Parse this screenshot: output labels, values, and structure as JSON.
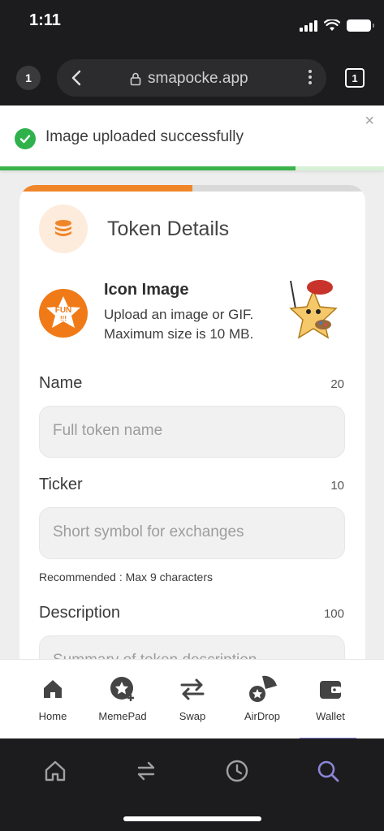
{
  "status_bar": {
    "time": "1:11"
  },
  "browser": {
    "tab_count_left": "1",
    "url": "smapocke.app",
    "tabs_count": "1"
  },
  "toast": {
    "message": "Image uploaded successfully",
    "close": "×",
    "progress": 0.77,
    "accent": "#3bb34a"
  },
  "card": {
    "progress": 0.5,
    "progress_color": "#f0862a",
    "title": "Token Details",
    "icon_section": {
      "logo_text": "FUN!!!",
      "title": "Icon Image",
      "desc_line1": "Upload an image or GIF.",
      "desc_line2": "Maximum size is 10 MB."
    },
    "fields": {
      "name": {
        "label": "Name",
        "count": "20",
        "placeholder": "Full token name"
      },
      "ticker": {
        "label": "Ticker",
        "count": "10",
        "placeholder": "Short symbol for exchanges",
        "hint": "Recommended : Max 9 characters"
      },
      "description": {
        "label": "Description",
        "count": "100",
        "placeholder": "Summary of token description"
      }
    }
  },
  "app_nav": {
    "items": [
      {
        "label": "Home",
        "icon": "home-icon"
      },
      {
        "label": "MemePad",
        "icon": "memepad-icon"
      },
      {
        "label": "Swap",
        "icon": "swap-icon"
      },
      {
        "label": "AirDrop",
        "icon": "airdrop-icon"
      },
      {
        "label": "Wallet",
        "icon": "wallet-icon"
      }
    ]
  },
  "browser_toolbar": {
    "icons": [
      "home-icon",
      "swap-icon",
      "history-icon",
      "search-icon"
    ],
    "active_color": "#8b86d8"
  }
}
